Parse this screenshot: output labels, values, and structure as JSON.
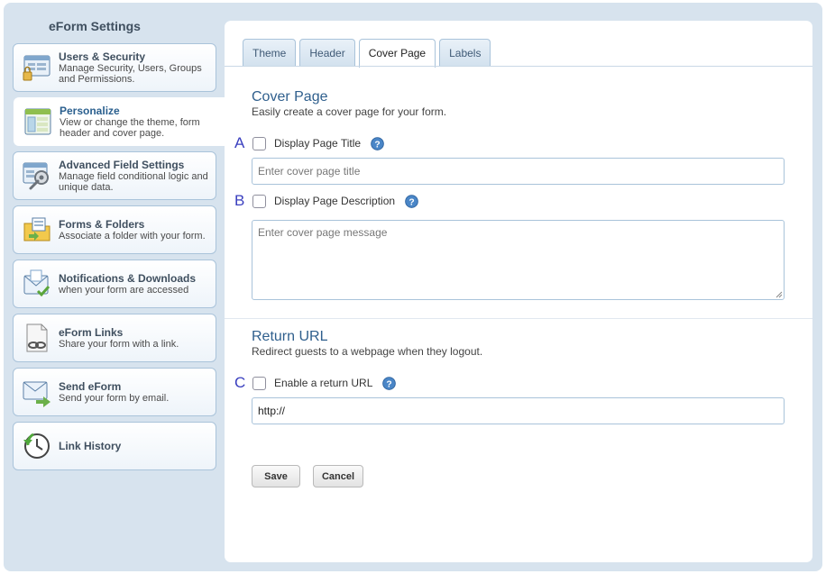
{
  "sidebar": {
    "title": "eForm Settings",
    "items": [
      {
        "name": "Users & Security",
        "desc": "Manage Security, Users, Groups and Permissions.",
        "icon": "users-security-icon"
      },
      {
        "name": "Personalize",
        "desc": "View or change the theme, form header and cover page.",
        "icon": "personalize-icon"
      },
      {
        "name": "Advanced Field Settings",
        "desc": "Manage field conditional logic and unique data.",
        "icon": "advanced-field-settings-icon"
      },
      {
        "name": "Forms & Folders",
        "desc": "Associate a folder with your form.",
        "icon": "forms-folders-icon"
      },
      {
        "name": "Notifications & Downloads",
        "desc": "when your form are accessed",
        "icon": "notifications-icon"
      },
      {
        "name": "eForm Links",
        "desc": "Share your form with a link.",
        "icon": "eform-links-icon"
      },
      {
        "name": "Send eForm",
        "desc": "Send your form by email.",
        "icon": "send-eform-icon"
      },
      {
        "name": "Link History",
        "desc": "",
        "icon": "link-history-icon"
      }
    ]
  },
  "tabs": [
    {
      "label": "Theme"
    },
    {
      "label": "Header"
    },
    {
      "label": "Cover Page"
    },
    {
      "label": "Labels"
    }
  ],
  "cover_page": {
    "title": "Cover Page",
    "subtitle": "Easily create a cover page for your form.",
    "marker_a": "A",
    "display_title_label": "Display Page Title",
    "title_placeholder": "Enter cover page title",
    "marker_b": "B",
    "display_desc_label": "Display Page Description",
    "message_placeholder": "Enter cover page message"
  },
  "return_url": {
    "title": "Return URL",
    "subtitle": "Redirect guests to a webpage when they logout.",
    "marker_c": "C",
    "enable_label": "Enable a return URL",
    "url_value": "http://"
  },
  "buttons": {
    "save": "Save",
    "cancel": "Cancel"
  },
  "colors": {
    "accent": "#2f5f8d",
    "frame": "#d7e3ee",
    "marker": "#3a3fbf",
    "help": "#4a86c7"
  }
}
